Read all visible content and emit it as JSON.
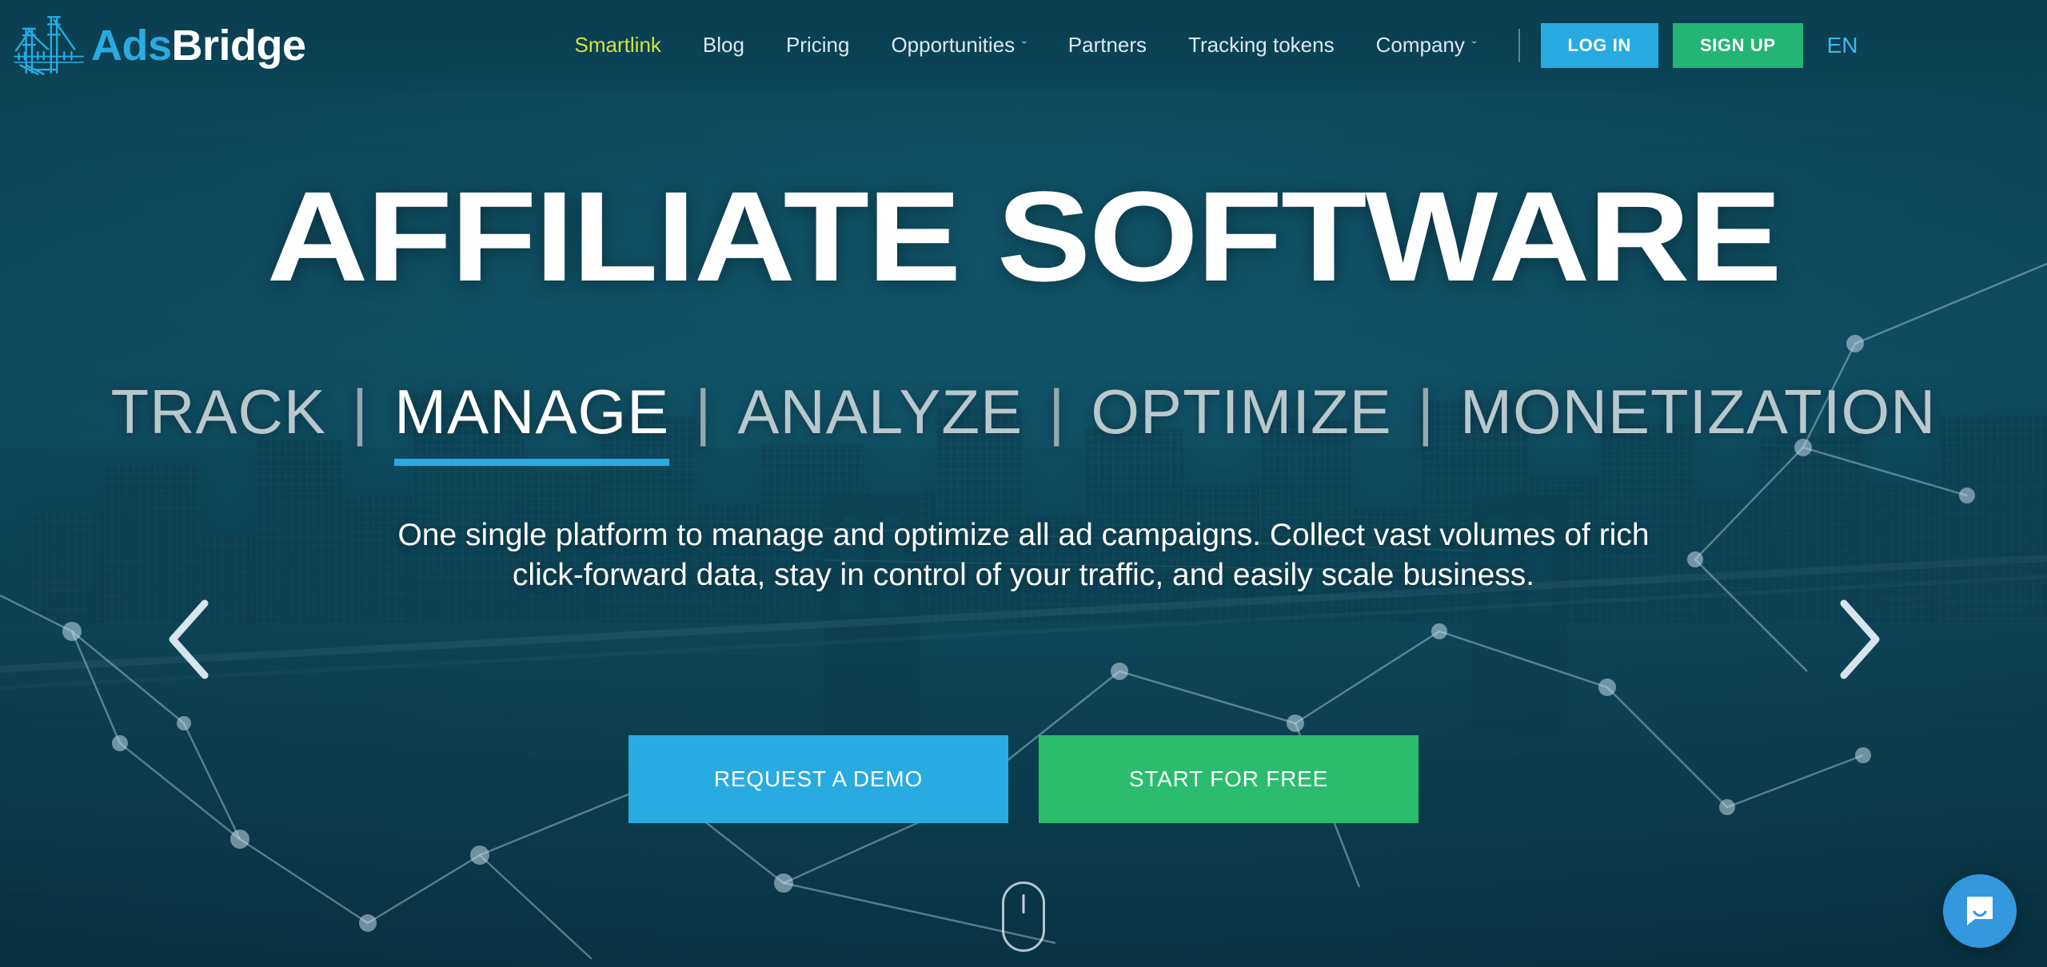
{
  "header": {
    "logo": {
      "icon": "bridge-logo-icon",
      "text_primary": "Ads",
      "text_secondary": "Bridge"
    },
    "nav": [
      {
        "label": "Smartlink",
        "accent": true,
        "caret": ""
      },
      {
        "label": "Blog",
        "accent": false,
        "caret": ""
      },
      {
        "label": "Pricing",
        "accent": false,
        "caret": ""
      },
      {
        "label": "Opportunities",
        "accent": false,
        "caret": "ˇ"
      },
      {
        "label": "Partners",
        "accent": false,
        "caret": ""
      },
      {
        "label": "Tracking tokens",
        "accent": false,
        "caret": ""
      },
      {
        "label": "Company",
        "accent": false,
        "caret": "ˇ"
      }
    ],
    "login_label": "LOG IN",
    "signup_label": "SIGN UP",
    "language": "EN"
  },
  "hero": {
    "title": "AFFILIATE SOFTWARE",
    "separator": "|",
    "subwords": [
      {
        "label": "TRACK",
        "active": false
      },
      {
        "label": "MANAGE",
        "active": true
      },
      {
        "label": "ANALYZE",
        "active": false
      },
      {
        "label": "OPTIMIZE",
        "active": false
      },
      {
        "label": "MONETIZATION",
        "active": false
      }
    ],
    "lead": "One single platform to manage and optimize all ad campaigns. Collect vast volumes of rich click-forward data, stay in control of your traffic, and easily scale business.",
    "cta_primary": "REQUEST A DEMO",
    "cta_secondary": "START FOR FREE",
    "prev_icon": "chevron-left-icon",
    "next_icon": "chevron-right-icon",
    "scroll_icon": "scroll-mouse-icon",
    "chat_icon": "chat-bubble-icon"
  },
  "colors": {
    "brand_blue": "#29abe2",
    "brand_green": "#22b573",
    "cta_green": "#2bbc6e",
    "accent_yellow": "#d7e33a",
    "bg_teal": "#0e4558",
    "chat_blue": "#3398dd",
    "nav_text": "#dbe9ef",
    "lang_blue": "#42b6e6"
  }
}
